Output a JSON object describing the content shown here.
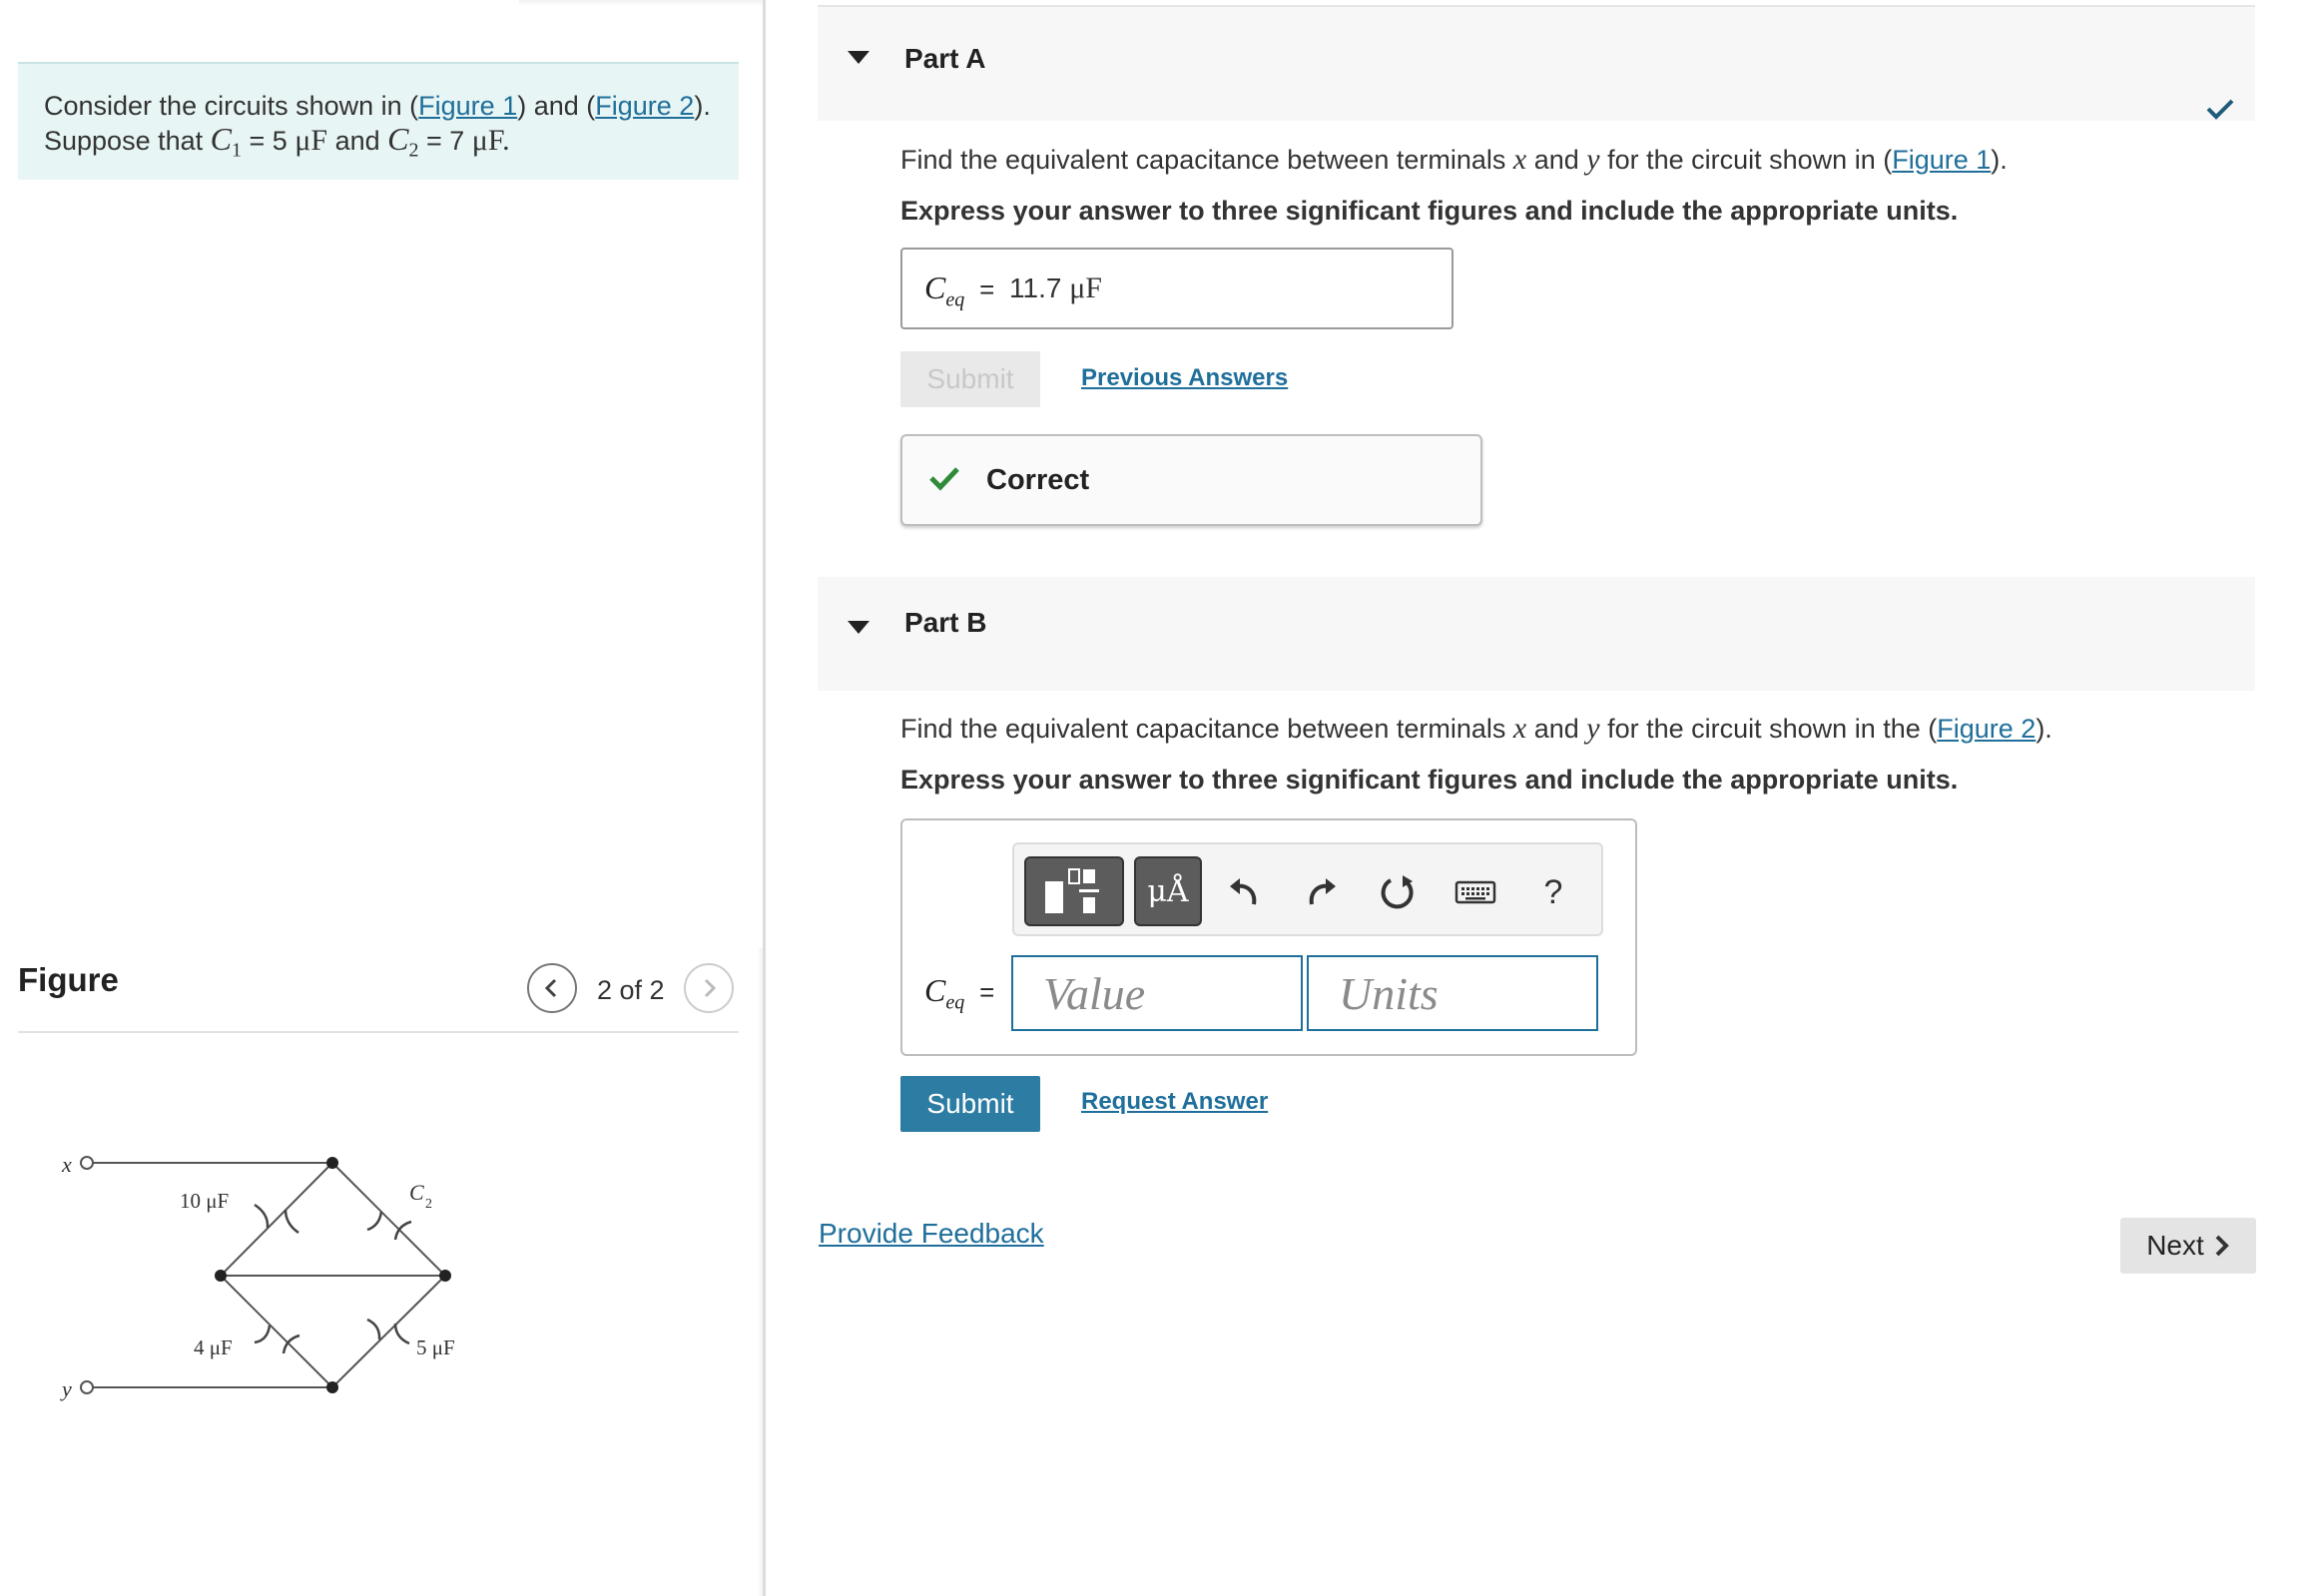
{
  "intro": {
    "text_1": "Consider the circuits shown in (",
    "figure1_link": "Figure 1",
    "text_2": ") and (",
    "figure2_link": "Figure 2",
    "text_3": ").",
    "text_4": "Suppose that ",
    "c1_symbol": "C",
    "c1_sub": "1",
    "c1_eq": " = 5 ",
    "c1_unit": "μF",
    "and": " and ",
    "c2_symbol": "C",
    "c2_sub": "2",
    "c2_eq": " = 7 ",
    "c2_unit": "μF."
  },
  "figure": {
    "label": "Figure",
    "counter": "2 of 2",
    "prev_icon": "chevron-left-icon",
    "next_icon": "chevron-right-icon",
    "circuit_labels": {
      "terminal_x": "x",
      "terminal_y": "y",
      "cap_top_left": "10 μF",
      "cap_top_right": "C",
      "cap_top_right_sub": "2",
      "cap_bottom_left": "4 μF",
      "cap_bottom_right": "5 μF"
    }
  },
  "partA": {
    "title": "Part A",
    "status_icon": "check-icon",
    "question_1": "Find the equivalent capacitance between terminals ",
    "var_x": "x",
    "question_2": " and ",
    "var_y": "y",
    "question_3": " for the circuit shown in (",
    "figure_link": "Figure 1",
    "question_4": ").",
    "instruction": "Express your answer to three significant figures and include the appropriate units.",
    "answer_label": "C",
    "answer_label_sub": "eq",
    "answer_eq": "=",
    "answer_value": "11.7 ",
    "answer_unit": "μF",
    "submit_label": "Submit",
    "previous_answers": "Previous Answers",
    "feedback_text": "Correct"
  },
  "partB": {
    "title": "Part B",
    "question_1": "Find the equivalent capacitance between terminals ",
    "var_x": "x",
    "question_2": " and ",
    "var_y": "y",
    "question_3": " for the circuit shown in the (",
    "figure_link": "Figure 2",
    "question_4": ").",
    "instruction": "Express your answer to three significant figures and include the appropriate units.",
    "toolbar": {
      "templates_icon": "templates-icon",
      "units_label": "μÅ",
      "undo_icon": "undo-icon",
      "redo_icon": "redo-icon",
      "reset_icon": "reset-icon",
      "keyboard_icon": "keyboard-icon",
      "help_label": "?"
    },
    "answer_label": "C",
    "answer_label_sub": "eq",
    "answer_eq": "=",
    "value_placeholder": "Value",
    "units_placeholder": "Units",
    "submit_label": "Submit",
    "request_answer": "Request Answer"
  },
  "footer": {
    "provide_feedback": "Provide Feedback",
    "next_label": "Next"
  },
  "colors": {
    "accent": "#2c7ca3",
    "link": "#1f6f9a",
    "correct_green": "#2e8b3a",
    "intro_bg": "#e8f5f5"
  }
}
